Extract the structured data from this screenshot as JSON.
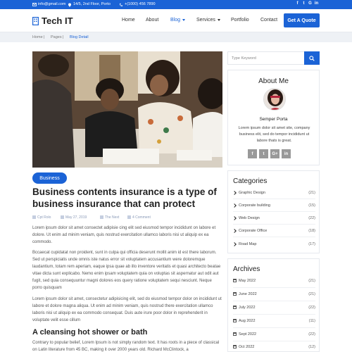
{
  "topbar": {
    "email": "info@gmail.com",
    "address": "14/5, 2nd Floor, Porto",
    "phone": "+(1000) 456 7890",
    "social_icons": [
      "facebook-icon",
      "twitter-icon",
      "google-plus-icon",
      "linkedin-icon"
    ],
    "social_glyphs": [
      "f",
      "t",
      "G",
      "in"
    ]
  },
  "header": {
    "brand": "Tech IT",
    "nav": [
      "Home",
      "About",
      "Blog",
      "Services",
      "Portfolio",
      "Contact"
    ],
    "active_nav": "Blog",
    "cta": "Get A Quote"
  },
  "breadcrumb": [
    "Home",
    "Pages",
    "Blog Detail"
  ],
  "post": {
    "category": "Business",
    "title": "Business contents insurance is a type of business insurance that can protect",
    "author": "Cpt Rolo",
    "date": "May 27, 2019",
    "tag": "The Next",
    "comments": "4 Comment",
    "paragraphs": [
      "Lorem ipsum dolor sit amet consectet adipisie cing elit sed eiusmod tempor incididunt on labore et dolore. Ut enim ad minim veniam, quis nostrud exercitation ullamco laboris nisi ut aliquip ex ea commodo.",
      "Bccaecat cupidatat non proident, sunt in culpa qui officia deserunt mollit anim id est there laborum. Sed ut perspiciatis unde omnis iste natus error sit voluptatem accusantium were doloremque laudantium, totam rem aperiam, eaque ipsa quae ab illo inventore veritatis et quasi architecto beatae vitae dicta sunt explicabo. Nemo enim ipsam voluptatem quia on voluptas sit aspernatur aut odit aut fugit, sed quia consequuntur magni dolores eos query ratione voluptatem sequi nesciunt. Neque porro quisquam",
      "Lorem ipsum dolor sit amet, consectetur adipisicing elit, sed do eiusmod tempor dolor on incididunt ut labore et dolore magna aliqua. Ut enim ad minim veniam, quis nostrud there exercitation ullamco laboris nisi ut aliquip ex ea commodo consequat. Duis aute irure poor dolor in reprehenderit in voluptate velit esse cillum"
    ],
    "subheading": "A cleansing hot shower or bath",
    "last_para": "Contrary to popular belief, Lorem Ipsum is not simply random text. It has roots in a piece of classical on Latin literature from 45 BC, making it over 2000 years old. Richard McClintock, a"
  },
  "sidebar": {
    "search_placeholder": "Type Keyword",
    "about": {
      "title": "About Me",
      "name": "Semper Porta",
      "bio": "Lorem ipsum dolor sit amet site, company business elit, sed do tempor incididunt ut labore thats is great.",
      "social_icons": [
        "facebook-icon",
        "twitter-icon",
        "google-plus-icon",
        "linkedin-icon"
      ],
      "social_glyphs": [
        "f",
        "t",
        "G+",
        "in"
      ]
    },
    "categories_title": "Categories",
    "categories": [
      {
        "label": "Graphic Design",
        "count": "(21)"
      },
      {
        "label": "Corporate building",
        "count": "(15)"
      },
      {
        "label": "Web Design",
        "count": "(22)"
      },
      {
        "label": "Corporate Office",
        "count": "(18)"
      },
      {
        "label": "Road Map",
        "count": "(17)"
      }
    ],
    "archives_title": "Archives",
    "archives": [
      {
        "label": "May 2022",
        "count": "(21)"
      },
      {
        "label": "June 2022",
        "count": "(21)"
      },
      {
        "label": "July 2022",
        "count": "(22)"
      },
      {
        "label": "Aug 2022",
        "count": "(11)"
      },
      {
        "label": "Sept 2022",
        "count": "(22)"
      },
      {
        "label": "Oct 2022",
        "count": "(12)"
      }
    ]
  },
  "colors": {
    "accent": "#1b63d6",
    "breadcrumb_bg": "#eef1f5"
  }
}
